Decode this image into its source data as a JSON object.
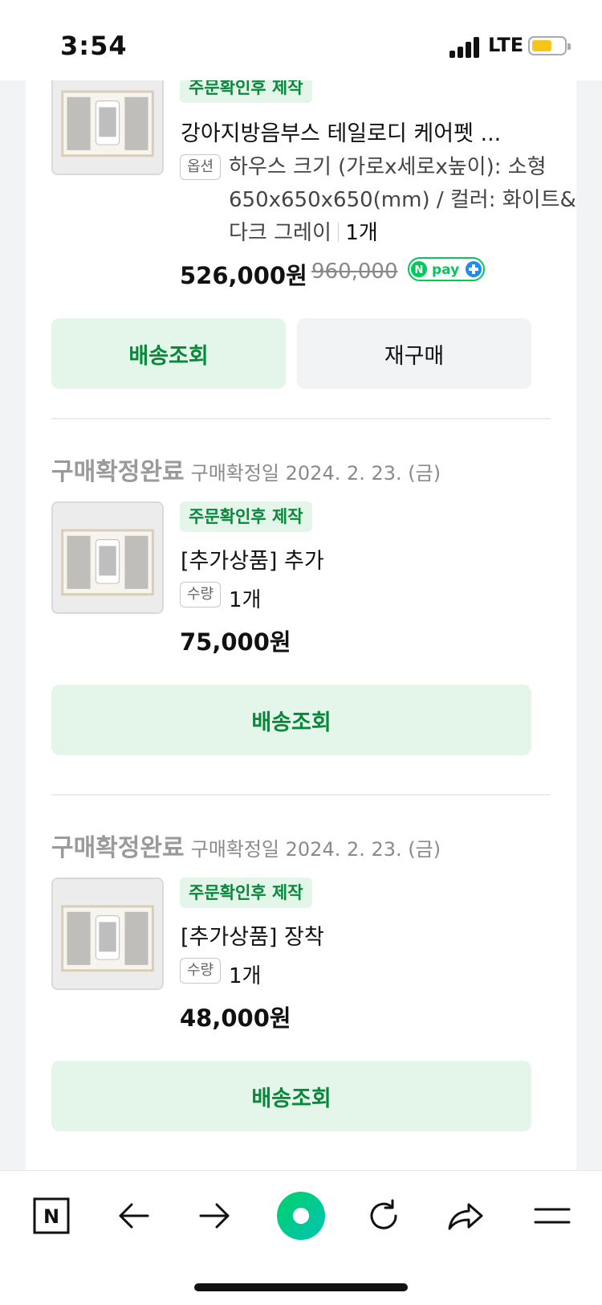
{
  "status_bar": {
    "time": "3:54",
    "network": "LTE",
    "battery_color": "#f5c518"
  },
  "colors": {
    "accent_green": "#07883b",
    "tag_bg": "#e4f6ea"
  },
  "orders": [
    {
      "tag": "주문확인후 제작",
      "title": "강아지방음부스 테일로디 케어펫 ...",
      "option_label": "옵션",
      "option_text": "하우스 크기 (가로x세로x높이): 소형 650x650x650(mm) / 컬러: 화이트&다크 그레이",
      "quantity": "1개",
      "price": "526,000원",
      "original_price": "960,000",
      "npay": "pay",
      "buttons": {
        "delivery": "배송조회",
        "rebuy": "재구매"
      }
    },
    {
      "status": "구매확정완료",
      "date": "구매확정일 2024. 2. 23. (금)",
      "tag": "주문확인후 제작",
      "title": "[추가상품] 추가",
      "qty_label": "수량",
      "quantity": "1개",
      "price": "75,000원",
      "buttons": {
        "delivery": "배송조회"
      }
    },
    {
      "status": "구매확정완료",
      "date": "구매확정일 2024. 2. 23. (금)",
      "tag": "주문확인후 제작",
      "title": "[추가상품] 장착",
      "qty_label": "수량",
      "quantity": "1개",
      "price": "48,000원",
      "buttons": {
        "delivery": "배송조회"
      }
    }
  ],
  "bottom_nav": {
    "icons": [
      "naver-n-icon",
      "back-arrow-icon",
      "forward-arrow-icon",
      "green-dot-icon",
      "refresh-icon",
      "share-icon",
      "menu-icon"
    ],
    "naver_letter": "N"
  }
}
